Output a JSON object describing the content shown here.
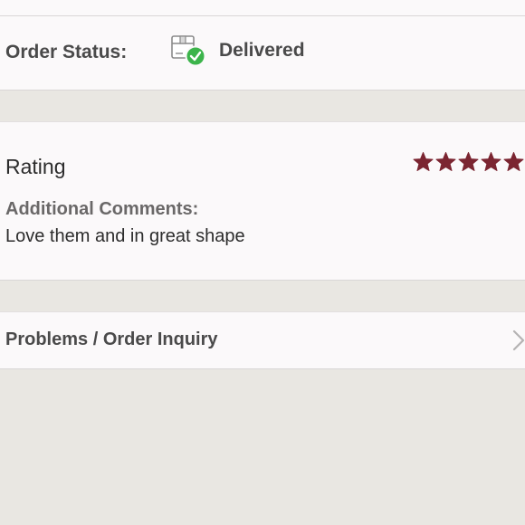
{
  "order_status": {
    "label": "Order Status:",
    "value": "Delivered",
    "icon": "package-delivered-icon",
    "status_color": "#3cb44b"
  },
  "rating": {
    "title": "Rating",
    "stars": 5,
    "max_stars": 5,
    "star_color": "#7b2531"
  },
  "comments": {
    "label": "Additional Comments:",
    "text": "Love them and in great shape"
  },
  "inquiry": {
    "label": "Problems / Order Inquiry",
    "icon": "chevron-right-icon"
  }
}
